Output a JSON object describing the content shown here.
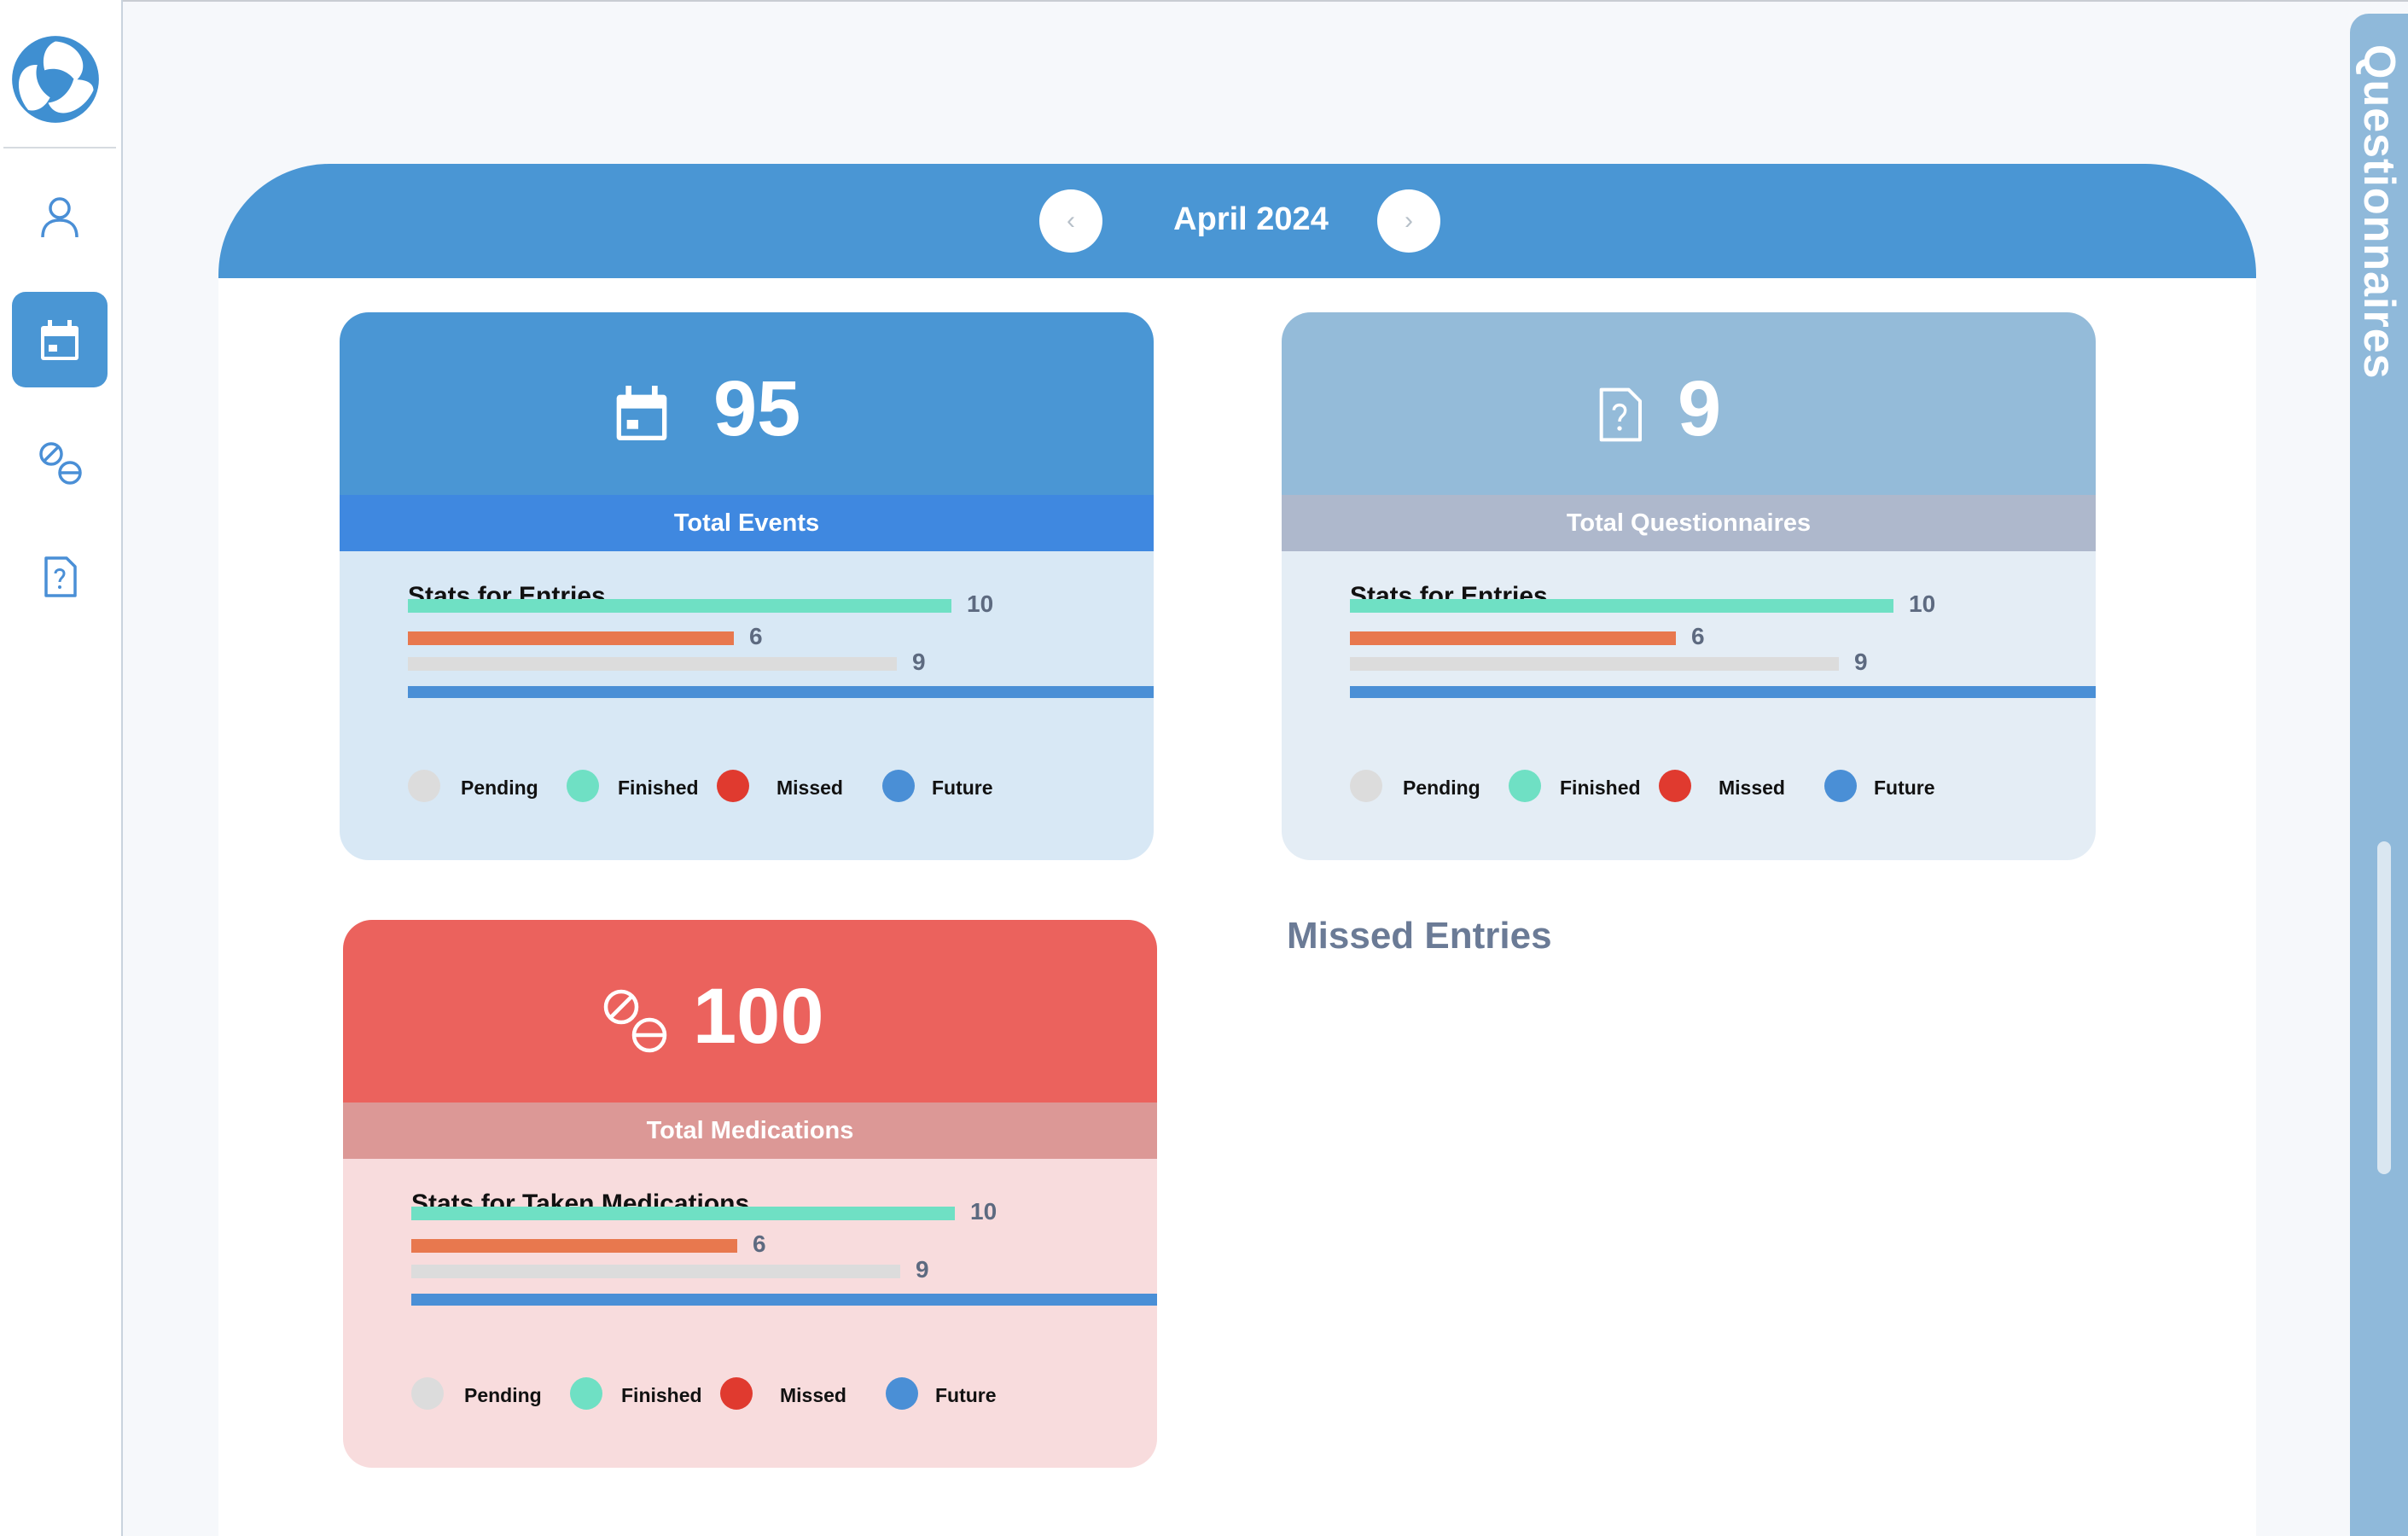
{
  "header": {
    "month_label": "April 2024",
    "prev_icon": "chevron-left-icon",
    "next_icon": "chevron-right-icon"
  },
  "sidebar": {
    "logo": "app-logo",
    "items": [
      {
        "name": "profile",
        "icon": "user-icon",
        "active": false
      },
      {
        "name": "events",
        "icon": "calendar-icon",
        "active": true
      },
      {
        "name": "medications",
        "icon": "pills-icon",
        "active": false
      },
      {
        "name": "questionnaires",
        "icon": "question-file-icon",
        "active": false
      }
    ]
  },
  "right_tab": {
    "label": "Questionnaires"
  },
  "legend": {
    "pending": "Pending",
    "finished": "Finished",
    "missed": "Missed",
    "future": "Future"
  },
  "colors": {
    "brand_blue": "#4a96d4",
    "finished": "#6fe0c4",
    "orange": "#e8784e",
    "pending": "#dcdcdc",
    "future": "#4a8fd6",
    "missed": "#e03a2f",
    "medication_red": "#eb625d"
  },
  "cards": {
    "events": {
      "icon": "calendar-icon",
      "total": "95",
      "label": "Total Events",
      "stats_title": "Stats for Entries",
      "bars": [
        10,
        6,
        9,
        14
      ]
    },
    "questionnaires": {
      "icon": "question-file-icon",
      "total": "9",
      "label": "Total Questionnaires",
      "stats_title": "Stats for Entries",
      "bars": [
        10,
        6,
        9,
        14
      ]
    },
    "medications": {
      "icon": "pills-icon",
      "total": "100",
      "label": "Total Medications",
      "stats_title": "Stats for Taken Medications",
      "bars": [
        10,
        6,
        9,
        14
      ]
    }
  },
  "missed_entries": {
    "title": "Missed Entries"
  }
}
